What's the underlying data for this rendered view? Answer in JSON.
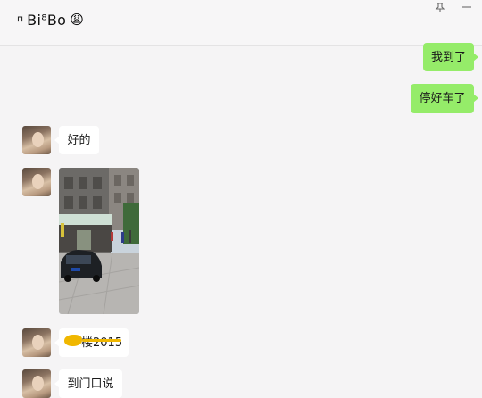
{
  "header": {
    "title_prefix": "⊓",
    "title": "Bi⁸Bo",
    "title_emoji": "😩"
  },
  "messages": [
    {
      "direction": "out",
      "text": "我到了"
    },
    {
      "direction": "out",
      "text": "停好车了"
    },
    {
      "direction": "in",
      "text": "好的"
    },
    {
      "direction": "in",
      "type": "image",
      "image": "street-photo-with-parked-car"
    },
    {
      "direction": "in",
      "text": "楼2015"
    },
    {
      "direction": "in",
      "text": "到门口说"
    }
  ],
  "colors": {
    "outgoing_bubble": "#95ec69",
    "incoming_bubble": "#ffffff",
    "chat_background": "#f5f4f5",
    "highlighter": "#f0b700"
  },
  "icons": {
    "pin": "pin-icon",
    "minimize": "minimize-icon"
  }
}
